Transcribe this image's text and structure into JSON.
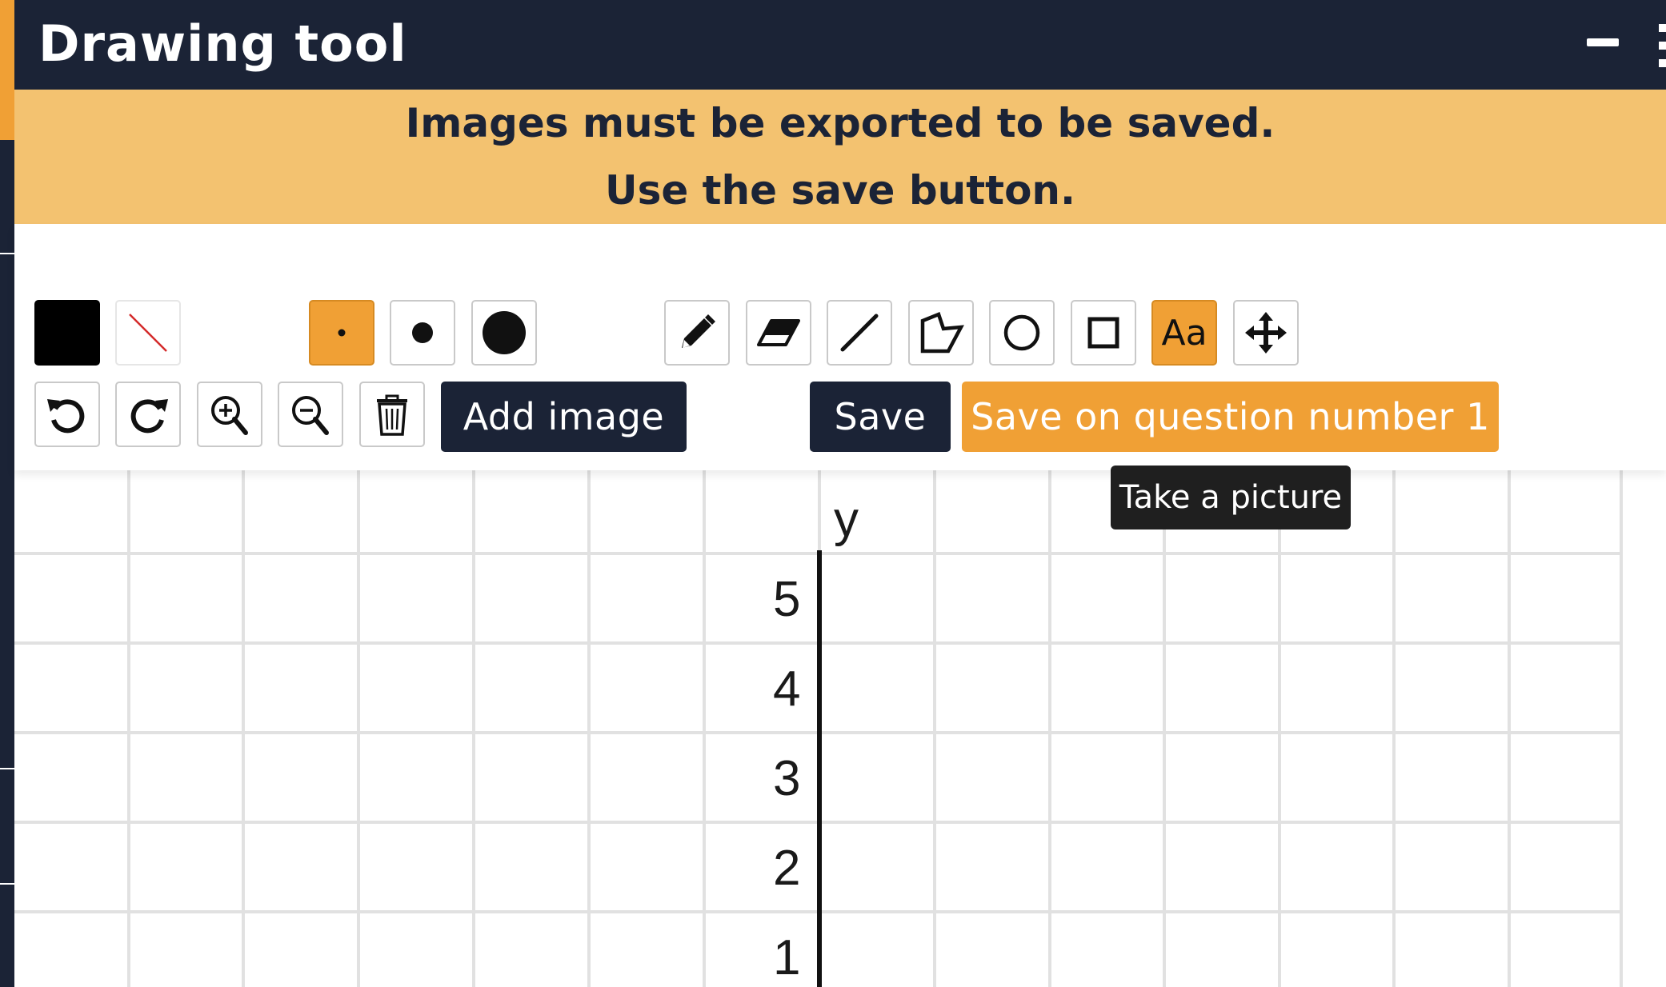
{
  "window": {
    "title": "Drawing tool"
  },
  "notice": {
    "line1": "Images must be exported to be saved.",
    "line2": "Use the save button."
  },
  "colors": {
    "stroke": "#000000",
    "fill": "none",
    "accent": "#f0a035",
    "dark": "#1b2336",
    "notice_bg": "#f3c270"
  },
  "toolbar": {
    "stroke_sizes": [
      {
        "icon": "small-dot-icon",
        "selected": true
      },
      {
        "icon": "medium-dot-icon",
        "selected": false
      },
      {
        "icon": "large-dot-icon",
        "selected": false
      }
    ],
    "tools": [
      {
        "name": "pencil",
        "icon": "pencil-icon",
        "selected": false
      },
      {
        "name": "eraser",
        "icon": "eraser-icon",
        "selected": false
      },
      {
        "name": "line",
        "icon": "line-icon",
        "selected": false
      },
      {
        "name": "polygon",
        "icon": "polygon-icon",
        "selected": false
      },
      {
        "name": "circle",
        "icon": "circle-icon",
        "selected": false
      },
      {
        "name": "rectangle",
        "icon": "square-icon",
        "selected": false
      },
      {
        "name": "text",
        "icon": "text-icon",
        "label": "Aa",
        "selected": true
      },
      {
        "name": "move",
        "icon": "move-icon",
        "selected": false
      }
    ],
    "actions": {
      "undo_icon": "undo-icon",
      "redo_icon": "redo-icon",
      "zoom_in_icon": "zoom-in-icon",
      "zoom_out_icon": "zoom-out-icon",
      "delete_icon": "trash-icon",
      "add_image": "Add image",
      "save": "Save",
      "save_on_question": "Save on question number 1"
    }
  },
  "tooltip": {
    "text": "Take a picture"
  },
  "canvas": {
    "y_axis_label": "y",
    "y_ticks": [
      "5",
      "4",
      "3",
      "2",
      "1"
    ]
  }
}
